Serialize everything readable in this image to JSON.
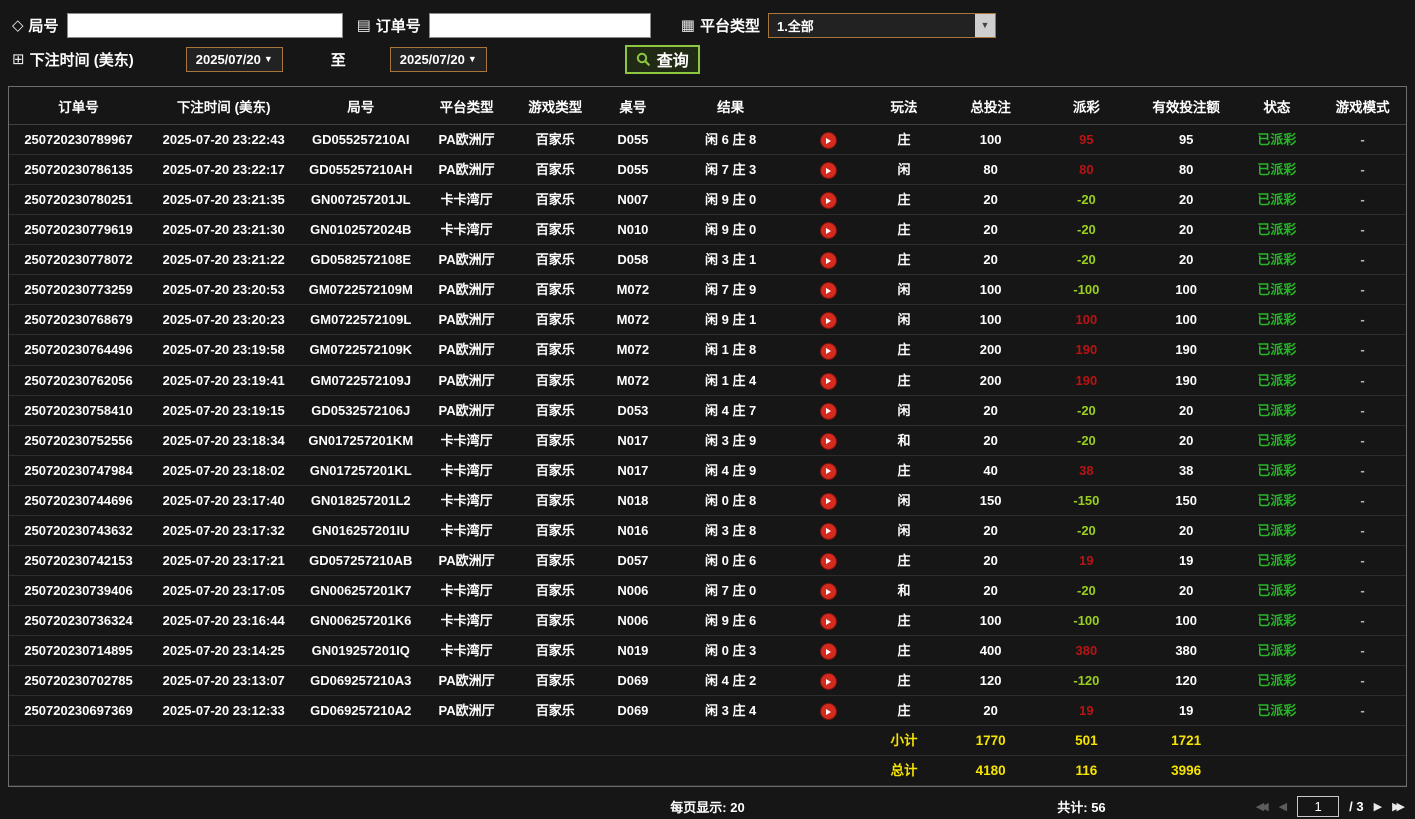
{
  "icons": {
    "tag": "◇",
    "document": "▤",
    "grid": "▦",
    "calendar": "⊞",
    "caret_down": "▼",
    "arrow_prev": "◀",
    "arrow_next": "▶",
    "arrow_first": "◀◀",
    "arrow_last": "▶▶"
  },
  "colors": {
    "payout_win_red": "#b81414",
    "payout_loss_green": "#9bcf1f",
    "status_green": "#28b428",
    "summary_yellow": "#f5e400",
    "select_border_tan": "#a8763b",
    "search_green": "#8dc63f",
    "play_red": "#d42b1e"
  },
  "filters": {
    "round_label": "局号",
    "round_value": "",
    "order_label": "订单号",
    "order_value": "",
    "platform_label": "平台类型",
    "platform_value": "1.全部",
    "bet_time_label": "下注时间 (美东)",
    "date_from": "2025/07/20",
    "to_label": "至",
    "date_to": "2025/07/20",
    "search_label": "查询"
  },
  "table": {
    "headers": [
      {
        "key": "order",
        "label": "订单号"
      },
      {
        "key": "time",
        "label": "下注时间 (美东)"
      },
      {
        "key": "round",
        "label": "局号"
      },
      {
        "key": "platform",
        "label": "平台类型"
      },
      {
        "key": "game",
        "label": "游戏类型"
      },
      {
        "key": "table",
        "label": "桌号"
      },
      {
        "key": "result",
        "label": "结果"
      },
      {
        "key": "play",
        "label": ""
      },
      {
        "key": "bet-type",
        "label": "玩法"
      },
      {
        "key": "total-bet",
        "label": "总投注"
      },
      {
        "key": "payout",
        "label": "派彩"
      },
      {
        "key": "valid-bet",
        "label": "有效投注额"
      },
      {
        "key": "status",
        "label": "状态"
      },
      {
        "key": "mode",
        "label": "游戏模式"
      }
    ],
    "rows": [
      {
        "order": "250720230789967",
        "time": "2025-07-20 23:22:43",
        "round": "GD055257210AI",
        "platform": "PA欧洲厅",
        "game": "百家乐",
        "table_no": "D055",
        "result": "闲 6 庄 8",
        "bet_type": "庄",
        "total_bet": "100",
        "payout": "95",
        "payout_color": "red",
        "valid_bet": "95",
        "status": "已派彩",
        "mode": "-"
      },
      {
        "order": "250720230786135",
        "time": "2025-07-20 23:22:17",
        "round": "GD055257210AH",
        "platform": "PA欧洲厅",
        "game": "百家乐",
        "table_no": "D055",
        "result": "闲 7 庄 3",
        "bet_type": "闲",
        "total_bet": "80",
        "payout": "80",
        "payout_color": "red",
        "valid_bet": "80",
        "status": "已派彩",
        "mode": "-"
      },
      {
        "order": "250720230780251",
        "time": "2025-07-20 23:21:35",
        "round": "GN007257201JL",
        "platform": "卡卡湾厅",
        "game": "百家乐",
        "table_no": "N007",
        "result": "闲 9 庄 0",
        "bet_type": "庄",
        "total_bet": "20",
        "payout": "-20",
        "payout_color": "green",
        "valid_bet": "20",
        "status": "已派彩",
        "mode": "-"
      },
      {
        "order": "250720230779619",
        "time": "2025-07-20 23:21:30",
        "round": "GN0102572024B",
        "platform": "卡卡湾厅",
        "game": "百家乐",
        "table_no": "N010",
        "result": "闲 9 庄 0",
        "bet_type": "庄",
        "total_bet": "20",
        "payout": "-20",
        "payout_color": "green",
        "valid_bet": "20",
        "status": "已派彩",
        "mode": "-"
      },
      {
        "order": "250720230778072",
        "time": "2025-07-20 23:21:22",
        "round": "GD0582572108E",
        "platform": "PA欧洲厅",
        "game": "百家乐",
        "table_no": "D058",
        "result": "闲 3 庄 1",
        "bet_type": "庄",
        "total_bet": "20",
        "payout": "-20",
        "payout_color": "green",
        "valid_bet": "20",
        "status": "已派彩",
        "mode": "-"
      },
      {
        "order": "250720230773259",
        "time": "2025-07-20 23:20:53",
        "round": "GM0722572109M",
        "platform": "PA欧洲厅",
        "game": "百家乐",
        "table_no": "M072",
        "result": "闲 7 庄 9",
        "bet_type": "闲",
        "total_bet": "100",
        "payout": "-100",
        "payout_color": "green",
        "valid_bet": "100",
        "status": "已派彩",
        "mode": "-"
      },
      {
        "order": "250720230768679",
        "time": "2025-07-20 23:20:23",
        "round": "GM0722572109L",
        "platform": "PA欧洲厅",
        "game": "百家乐",
        "table_no": "M072",
        "result": "闲 9 庄 1",
        "bet_type": "闲",
        "total_bet": "100",
        "payout": "100",
        "payout_color": "red",
        "valid_bet": "100",
        "status": "已派彩",
        "mode": "-"
      },
      {
        "order": "250720230764496",
        "time": "2025-07-20 23:19:58",
        "round": "GM0722572109K",
        "platform": "PA欧洲厅",
        "game": "百家乐",
        "table_no": "M072",
        "result": "闲 1 庄 8",
        "bet_type": "庄",
        "total_bet": "200",
        "payout": "190",
        "payout_color": "red",
        "valid_bet": "190",
        "status": "已派彩",
        "mode": "-"
      },
      {
        "order": "250720230762056",
        "time": "2025-07-20 23:19:41",
        "round": "GM0722572109J",
        "platform": "PA欧洲厅",
        "game": "百家乐",
        "table_no": "M072",
        "result": "闲 1 庄 4",
        "bet_type": "庄",
        "total_bet": "200",
        "payout": "190",
        "payout_color": "red",
        "valid_bet": "190",
        "status": "已派彩",
        "mode": "-"
      },
      {
        "order": "250720230758410",
        "time": "2025-07-20 23:19:15",
        "round": "GD0532572106J",
        "platform": "PA欧洲厅",
        "game": "百家乐",
        "table_no": "D053",
        "result": "闲 4 庄 7",
        "bet_type": "闲",
        "total_bet": "20",
        "payout": "-20",
        "payout_color": "green",
        "valid_bet": "20",
        "status": "已派彩",
        "mode": "-"
      },
      {
        "order": "250720230752556",
        "time": "2025-07-20 23:18:34",
        "round": "GN017257201KM",
        "platform": "卡卡湾厅",
        "game": "百家乐",
        "table_no": "N017",
        "result": "闲 3 庄 9",
        "bet_type": "和",
        "total_bet": "20",
        "payout": "-20",
        "payout_color": "green",
        "valid_bet": "20",
        "status": "已派彩",
        "mode": "-"
      },
      {
        "order": "250720230747984",
        "time": "2025-07-20 23:18:02",
        "round": "GN017257201KL",
        "platform": "卡卡湾厅",
        "game": "百家乐",
        "table_no": "N017",
        "result": "闲 4 庄 9",
        "bet_type": "庄",
        "total_bet": "40",
        "payout": "38",
        "payout_color": "red",
        "valid_bet": "38",
        "status": "已派彩",
        "mode": "-"
      },
      {
        "order": "250720230744696",
        "time": "2025-07-20 23:17:40",
        "round": "GN018257201L2",
        "platform": "卡卡湾厅",
        "game": "百家乐",
        "table_no": "N018",
        "result": "闲 0 庄 8",
        "bet_type": "闲",
        "total_bet": "150",
        "payout": "-150",
        "payout_color": "green",
        "valid_bet": "150",
        "status": "已派彩",
        "mode": "-"
      },
      {
        "order": "250720230743632",
        "time": "2025-07-20 23:17:32",
        "round": "GN016257201IU",
        "platform": "卡卡湾厅",
        "game": "百家乐",
        "table_no": "N016",
        "result": "闲 3 庄 8",
        "bet_type": "闲",
        "total_bet": "20",
        "payout": "-20",
        "payout_color": "green",
        "valid_bet": "20",
        "status": "已派彩",
        "mode": "-"
      },
      {
        "order": "250720230742153",
        "time": "2025-07-20 23:17:21",
        "round": "GD057257210AB",
        "platform": "PA欧洲厅",
        "game": "百家乐",
        "table_no": "D057",
        "result": "闲 0 庄 6",
        "bet_type": "庄",
        "total_bet": "20",
        "payout": "19",
        "payout_color": "red",
        "valid_bet": "19",
        "status": "已派彩",
        "mode": "-"
      },
      {
        "order": "250720230739406",
        "time": "2025-07-20 23:17:05",
        "round": "GN006257201K7",
        "platform": "卡卡湾厅",
        "game": "百家乐",
        "table_no": "N006",
        "result": "闲 7 庄 0",
        "bet_type": "和",
        "total_bet": "20",
        "payout": "-20",
        "payout_color": "green",
        "valid_bet": "20",
        "status": "已派彩",
        "mode": "-"
      },
      {
        "order": "250720230736324",
        "time": "2025-07-20 23:16:44",
        "round": "GN006257201K6",
        "platform": "卡卡湾厅",
        "game": "百家乐",
        "table_no": "N006",
        "result": "闲 9 庄 6",
        "bet_type": "庄",
        "total_bet": "100",
        "payout": "-100",
        "payout_color": "green",
        "valid_bet": "100",
        "status": "已派彩",
        "mode": "-"
      },
      {
        "order": "250720230714895",
        "time": "2025-07-20 23:14:25",
        "round": "GN019257201IQ",
        "platform": "卡卡湾厅",
        "game": "百家乐",
        "table_no": "N019",
        "result": "闲 0 庄 3",
        "bet_type": "庄",
        "total_bet": "400",
        "payout": "380",
        "payout_color": "red",
        "valid_bet": "380",
        "status": "已派彩",
        "mode": "-"
      },
      {
        "order": "250720230702785",
        "time": "2025-07-20 23:13:07",
        "round": "GD069257210A3",
        "platform": "PA欧洲厅",
        "game": "百家乐",
        "table_no": "D069",
        "result": "闲 4 庄 2",
        "bet_type": "庄",
        "total_bet": "120",
        "payout": "-120",
        "payout_color": "green",
        "valid_bet": "120",
        "status": "已派彩",
        "mode": "-"
      },
      {
        "order": "250720230697369",
        "time": "2025-07-20 23:12:33",
        "round": "GD069257210A2",
        "platform": "PA欧洲厅",
        "game": "百家乐",
        "table_no": "D069",
        "result": "闲 3 庄 4",
        "bet_type": "庄",
        "total_bet": "20",
        "payout": "19",
        "payout_color": "red",
        "valid_bet": "19",
        "status": "已派彩",
        "mode": "-"
      }
    ]
  },
  "summary": {
    "subtotal_label": "小计",
    "subtotal_total_bet": "1770",
    "subtotal_payout": "501",
    "subtotal_valid_bet": "1721",
    "total_label": "总计",
    "total_total_bet": "4180",
    "total_payout": "116",
    "total_valid_bet": "3996"
  },
  "footer": {
    "per_page": "每页显示: 20",
    "total_count": "共计: 56",
    "current_page": "1",
    "page_separator": "/",
    "total_pages": "3"
  }
}
